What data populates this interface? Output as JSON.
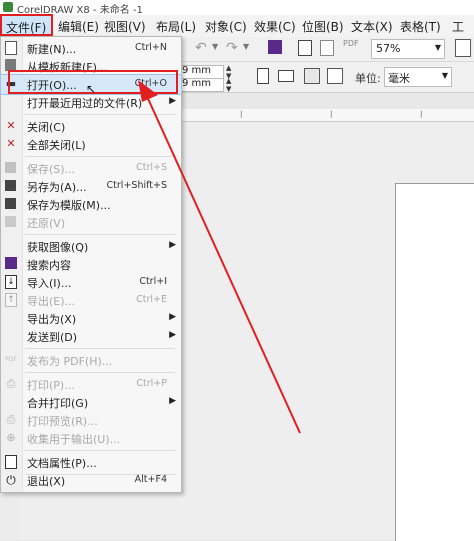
{
  "window": {
    "title": "CorelDRAW X8 - 未命名 -1"
  },
  "menubar": {
    "items": [
      "文件(F)",
      "编辑(E)",
      "视图(V)",
      "布局(L)",
      "对象(C)",
      "效果(C)",
      "位图(B)",
      "文本(X)",
      "表格(T)",
      "工"
    ]
  },
  "toolbar": {
    "zoom": "57%",
    "coord1": "9 mm",
    "coord2": "9 mm",
    "units_label": "单位:",
    "units_value": "毫米"
  },
  "file_menu": {
    "items": [
      {
        "label": "新建(N)...",
        "shortcut": "Ctrl+N",
        "icon": "new-doc-icon",
        "enabled": true
      },
      {
        "label": "从模板新建(F)...",
        "shortcut": "",
        "icon": "template-icon",
        "enabled": true
      },
      {
        "label": "打开(O)...",
        "shortcut": "Ctrl+O",
        "icon": "open-folder-icon",
        "enabled": true
      },
      {
        "label": "打开最近用过的文件(R)",
        "shortcut": "",
        "icon": "",
        "enabled": true,
        "submenu": true
      },
      {
        "label": "关闭(C)",
        "shortcut": "",
        "icon": "close-doc-icon",
        "enabled": true
      },
      {
        "label": "全部关闭(L)",
        "shortcut": "",
        "icon": "close-all-icon",
        "enabled": true
      },
      {
        "label": "保存(S)...",
        "shortcut": "Ctrl+S",
        "icon": "save-icon",
        "enabled": false
      },
      {
        "label": "另存为(A)...",
        "shortcut": "Ctrl+Shift+S",
        "icon": "save-as-icon",
        "enabled": true
      },
      {
        "label": "保存为模版(M)...",
        "shortcut": "",
        "icon": "save-template-icon",
        "enabled": true
      },
      {
        "label": "还原(V)",
        "shortcut": "",
        "icon": "revert-icon",
        "enabled": false
      },
      {
        "label": "获取图像(Q)",
        "shortcut": "",
        "icon": "",
        "enabled": true,
        "submenu": true
      },
      {
        "label": "搜索内容",
        "shortcut": "",
        "icon": "search-content-icon",
        "enabled": true
      },
      {
        "label": "导入(I)...",
        "shortcut": "Ctrl+I",
        "icon": "import-icon",
        "enabled": true
      },
      {
        "label": "导出(E)...",
        "shortcut": "Ctrl+E",
        "icon": "export-icon",
        "enabled": false
      },
      {
        "label": "导出为(X)",
        "shortcut": "",
        "icon": "",
        "enabled": true,
        "submenu": true
      },
      {
        "label": "发送到(D)",
        "shortcut": "",
        "icon": "",
        "enabled": true,
        "submenu": true
      },
      {
        "label": "发布为 PDF(H)...",
        "shortcut": "",
        "icon": "pdf-icon",
        "enabled": false
      },
      {
        "label": "打印(P)...",
        "shortcut": "Ctrl+P",
        "icon": "print-icon",
        "enabled": false
      },
      {
        "label": "合并打印(G)",
        "shortcut": "",
        "icon": "",
        "enabled": true,
        "submenu": true
      },
      {
        "label": "打印预览(R)...",
        "shortcut": "",
        "icon": "print-preview-icon",
        "enabled": false
      },
      {
        "label": "收集用于输出(U)...",
        "shortcut": "",
        "icon": "collect-icon",
        "enabled": false
      },
      {
        "label": "文档属性(P)...",
        "shortcut": "",
        "icon": "doc-properties-icon",
        "enabled": true
      },
      {
        "label": "退出(X)",
        "shortcut": "Alt+F4",
        "icon": "exit-icon",
        "enabled": true
      }
    ]
  },
  "annotation": {
    "color": "#e02020"
  },
  "colors": {
    "highlight": "#d6e8f8",
    "disabled_text": "#a9a9a9"
  }
}
